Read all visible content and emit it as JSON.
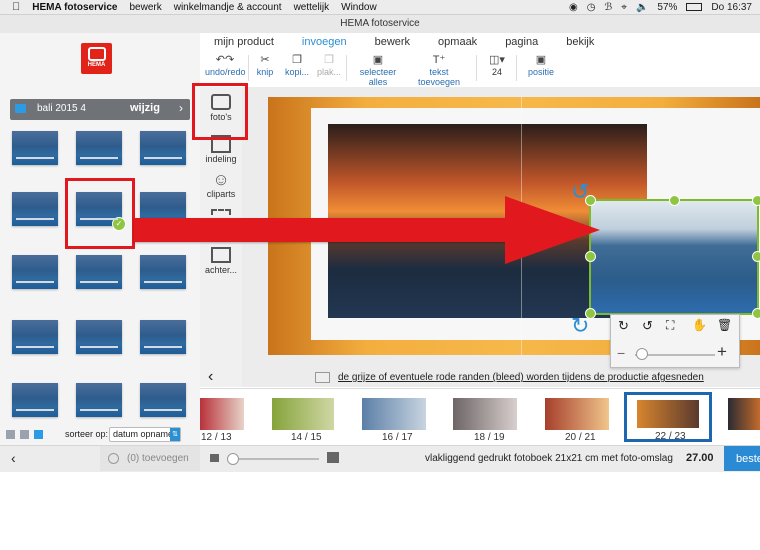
{
  "menubar": {
    "app_name": "HEMA fotoservice",
    "items": [
      "bewerk",
      "winkelmandje & account",
      "wettelijk",
      "Window"
    ],
    "battery": "57%",
    "clock": "Do 16:37"
  },
  "window_title": "HEMA fotoservice",
  "logo_text": "HEMA",
  "tabs": [
    {
      "label": "mijn product"
    },
    {
      "label": "invoegen"
    },
    {
      "label": "bewerk"
    },
    {
      "label": "opmaak"
    },
    {
      "label": "pagina"
    },
    {
      "label": "bekijk"
    }
  ],
  "toolbar": {
    "undo": "undo/redo",
    "cut": "knip",
    "copy": "kopi...",
    "paste": "plak...",
    "select_all": "selecteer alles",
    "add_text": "tekst toevoegen",
    "columns": "24",
    "position": "positie"
  },
  "album": {
    "name": "bali 2015 4",
    "action": "wijzig"
  },
  "side_tools": [
    "foto's",
    "indeling",
    "cliparts",
    "achter..."
  ],
  "sort": {
    "label": "sorteer op:",
    "value": "datum opname"
  },
  "bleed_note": "de grijze of eventuele rode randen (bleed) worden tijdens de productie afgesneden",
  "pages": [
    "12 / 13",
    "14 / 15",
    "16 / 17",
    "18 / 19",
    "20 / 21",
    "22 / 23"
  ],
  "bottom": {
    "add_label": "(0) toevoegen",
    "product": "vlakliggend gedrukt fotoboek 21x21 cm met foto-omslag",
    "price": "27.00",
    "order": "beste"
  },
  "colors": {
    "accent": "#2b8fd4",
    "hema_red": "#e2231a",
    "highlight_red": "#e1191e",
    "selection_green": "#7dbb2c"
  }
}
